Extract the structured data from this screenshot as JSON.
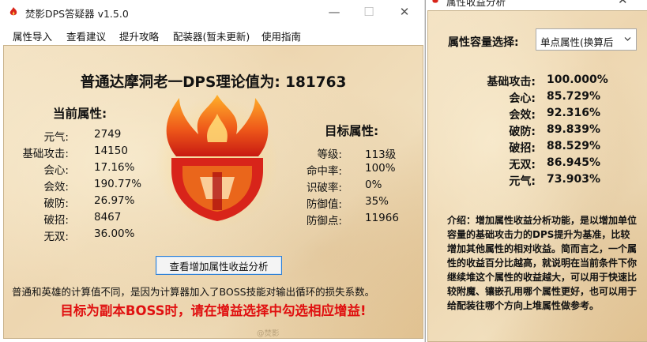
{
  "main_window": {
    "title": "焚影DPS答疑器  v1.5.0",
    "controls": {
      "minimize": "—",
      "maximize": "☐",
      "close": "✕"
    },
    "menu": [
      "属性导入",
      "查看建议",
      "提升攻略",
      "配装器(暂未更新)",
      "使用指南"
    ],
    "headline": "普通达摩洞老一DPS理论值为: 181763",
    "current_attrs": {
      "title": "当前属性:",
      "items": [
        {
          "label": "元气:",
          "value": "2749"
        },
        {
          "label": "基础攻击:",
          "value": "14150"
        },
        {
          "label": "会心:",
          "value": "17.16%"
        },
        {
          "label": "会效:",
          "value": "190.77%"
        },
        {
          "label": "破防:",
          "value": "26.97%"
        },
        {
          "label": "破招:",
          "value": "8467"
        },
        {
          "label": "无双:",
          "value": "36.00%"
        }
      ]
    },
    "target_attrs": {
      "title": "目标属性:",
      "items": [
        {
          "label": "等级:",
          "value": "113级"
        },
        {
          "label": "命中率:",
          "value": "100%"
        },
        {
          "label": "识破率:",
          "value": "0%"
        },
        {
          "label": "防御值:",
          "value": "35%"
        },
        {
          "label": "防御点:",
          "value": "11966"
        }
      ]
    },
    "analyze_button": "查看增加属性收益分析",
    "note": "普通和英雄的计算值不同，是因为计算器加入了BOSS技能对输出循环的损失系数。",
    "warning": "目标为副本BOSS时，请在增益选择中勾选相应增益!",
    "watermark": "@焚影"
  },
  "analysis_window": {
    "title": "属性收益分析",
    "close": "✕",
    "capacity_label": "属性容量选择:",
    "capacity_select": "单点属性(换算后",
    "ratios": [
      {
        "label": "基础攻击:",
        "value": "100.000%"
      },
      {
        "label": "会心:",
        "value": "85.729%"
      },
      {
        "label": "会效:",
        "value": "92.316%"
      },
      {
        "label": "破防:",
        "value": "89.839%"
      },
      {
        "label": "破招:",
        "value": "88.529%"
      },
      {
        "label": "无双:",
        "value": "86.945%"
      },
      {
        "label": "元气:",
        "value": "73.903%"
      }
    ],
    "intro": "介绍：增加属性收益分析功能，是以增加单位容量的基础攻击力的DPS提升为基准，比较增加其他属性的相对收益。简而言之，一个属性的收益百分比越高，就说明在当前条件下你继续堆这个属性的收益越大，可以用于快速比较附魔、镶嵌孔用哪个属性更好，也可以用于给配装往哪个方向上堆属性做参考。"
  },
  "colors": {
    "warning_red": "#e01010",
    "button_border": "#2d7fd6",
    "parchment": "#efdcb8",
    "emblem_red": "#d8241a",
    "emblem_orange": "#f58a1c"
  },
  "icons": {
    "app": "flame-icon",
    "emblem": "flame-crest-logo",
    "select": "chevron-down-icon"
  }
}
